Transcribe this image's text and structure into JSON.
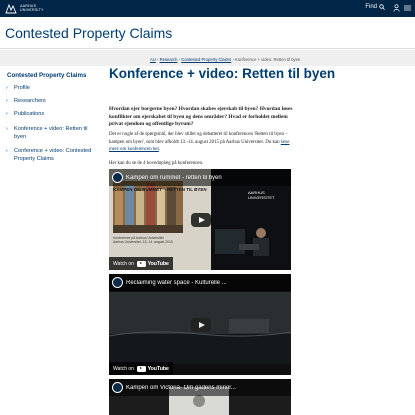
{
  "header": {
    "logo_text_line1": "AARHUS",
    "logo_text_line2": "UNIVERSITY",
    "find_label": "Find"
  },
  "site": {
    "title": "Contested Property Claims"
  },
  "sidebar": {
    "heading": "Contested Property Claims",
    "items": [
      {
        "label": "Profile"
      },
      {
        "label": "Researchers"
      },
      {
        "label": "Publications"
      },
      {
        "label": "Konference + video: Retten til byen"
      },
      {
        "label": "Conference + video: Contested Property Claims"
      }
    ]
  },
  "breadcrumb": {
    "items": [
      "AU",
      "Research",
      "Contested Property Claims"
    ],
    "current": "Konference + video: Retten til byen"
  },
  "article": {
    "title": "Konference + video: Retten til byen",
    "lead": "Hvordan ejer borgerne byen? Hvordan skabes ejerskab til byen? Hvordan løses konflikter om ejerskabet til byen og dens områder? Hvad er forholdet mellem privat ejendom og offentlige byrum?",
    "paragraph_text": "Det er nogle af de spørgsmål, der blev stillet og debatteret til konferencen 'Retten til byen – kampen om byen', som blev afholdt 13.-14. august 2015 på Aarhus Universitet. Du kan ",
    "paragraph_link": "læse mere om konferencen her",
    "paragraph_end": ".",
    "paragraph2": "Her kan du se de 4 hovedoplæg på konferencen."
  },
  "videos": [
    {
      "title": "Kampen om rummet - retten til byen",
      "overlay_heading": "KAMPEN OM RUMMET – RETTEN TIL BYEN",
      "overlay_sub1": "Konference på Aarhus Universitet",
      "overlay_sub2": "Aarhus Universitet, 13.-14. august 2015",
      "brand": "AARHUS UNIVERSITET",
      "watch_label": "Watch on",
      "yt_label": "YouTube"
    },
    {
      "title": "Reclaiming water space - Kulturelle ...",
      "watch_label": "Watch on",
      "yt_label": "YouTube"
    },
    {
      "title": "Kampen om Victoria- Om gadens minor...",
      "watch_label": "",
      "yt_label": ""
    }
  ],
  "share_label": "Share",
  "colors": {
    "topbar": "#002546",
    "brand_blue": "#003d73",
    "grey_bg": "#f0efef"
  }
}
